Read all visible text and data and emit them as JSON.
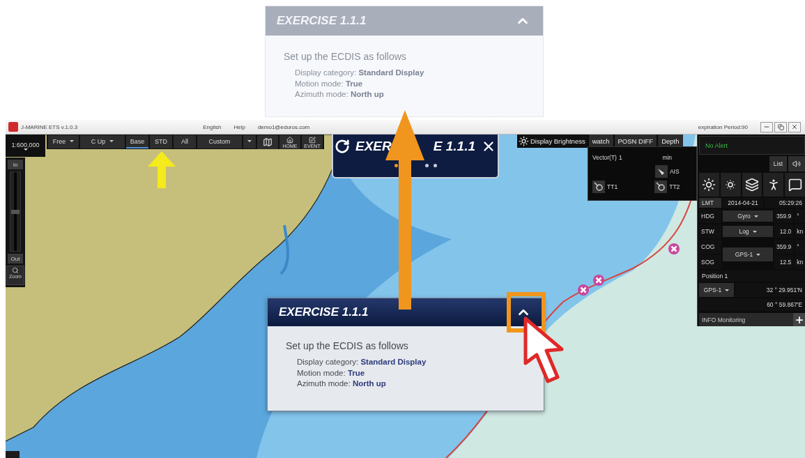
{
  "preview_panel": {
    "faded": true,
    "title": "EXERCISE 1.1.1",
    "intro": "Set up the ECDIS as follows",
    "items": [
      "Display category: **Standard Display**",
      "Motion mode: **True**",
      "Azimuth mode: **North up**"
    ]
  },
  "window": {
    "app_title": "J-MARINE ETS v.1.0.3",
    "menu": [
      "English",
      "Help"
    ],
    "user": "demo1@eduros.com",
    "expiration": "expiration Period:90"
  },
  "scale": "1:600,000",
  "zoom": {
    "in_label": "In",
    "out_label": "Out",
    "zoom_label": "Zoom",
    "level": 0.5
  },
  "toolbar": [
    {
      "kind": "dropdown",
      "label": "Free",
      "selected": false
    },
    {
      "kind": "dropdown",
      "label": "C Up",
      "selected": false
    },
    {
      "kind": "toggle",
      "label": "Base",
      "selected": true
    },
    {
      "kind": "toggle",
      "label": "STD",
      "selected": false
    },
    {
      "kind": "toggle",
      "label": "All",
      "selected": false
    },
    {
      "kind": "toggle",
      "label": "Custom",
      "selected": false
    },
    {
      "kind": "caret",
      "selected": false
    },
    {
      "kind": "icon",
      "selected": false
    },
    {
      "kind": "icon",
      "label": "HOME",
      "selected": false
    },
    {
      "kind": "icon",
      "label": "EVENT",
      "selected": false
    }
  ],
  "exercise_badge": {
    "title_start": "EXER",
    "title_end": "E 1.1.1",
    "dots": [
      {
        "selected": true
      },
      {
        "selected": false
      },
      {
        "selected": false
      }
    ]
  },
  "brightness": "Display Brightness",
  "display_tabs": [
    "watch",
    "POSN DIFF",
    "Depth"
  ],
  "vector_panel": {
    "label": "Vector(T)",
    "value": "1",
    "unit": "min",
    "ais": "AIS",
    "targets": [
      "TT1",
      "TT2"
    ]
  },
  "right_panel": {
    "alert": "No Alert",
    "list": "List",
    "time": {
      "label": "LMT",
      "date": "2014-04-21",
      "clock": "05:29:26"
    },
    "heading_rows": [
      {
        "label": "HDG",
        "source": "Gyro",
        "value": "359.9",
        "unit": "°"
      },
      {
        "label": "STW",
        "source": "Log",
        "value": "12.0",
        "unit": "kn"
      }
    ],
    "course": {
      "source": "GPS-1",
      "rows": [
        {
          "label": "COG",
          "value": "359.9",
          "unit": "°"
        },
        {
          "label": "SOG",
          "value": "12.5",
          "unit": "kn"
        }
      ]
    },
    "position": {
      "title": "Position 1",
      "source": "GPS-1",
      "lat": "32 ° 29.951'N",
      "lon": "60 ° 59.867'E"
    },
    "info": "INFO Monitoring"
  },
  "exercise_panel": {
    "faded": false,
    "title": "EXERCISE 1.1.1",
    "intro": "Set up the ECDIS as follows",
    "items": [
      "Display category: **Standard Display**",
      "Motion mode: **True**",
      "Azimuth mode: **North up**"
    ]
  }
}
